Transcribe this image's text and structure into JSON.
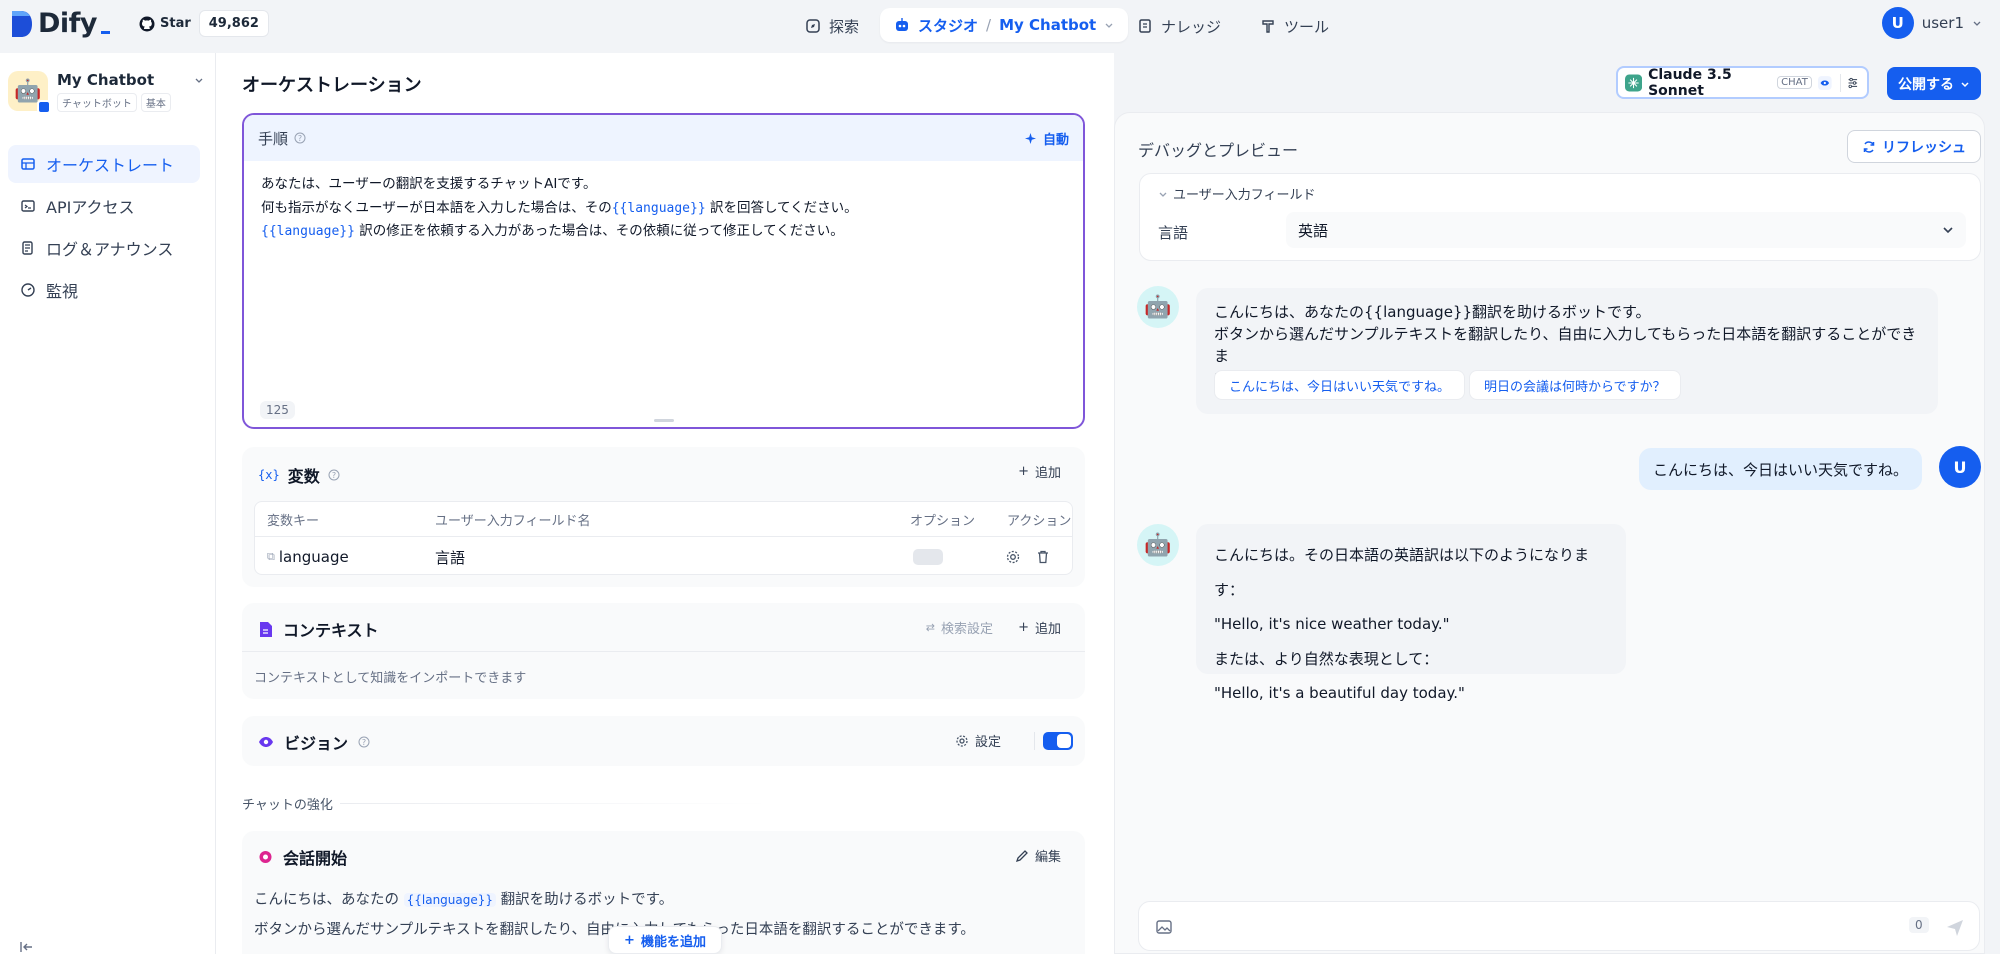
{
  "topnav": {
    "logo": "Dify",
    "star_label": "Star",
    "star_count": "49,862",
    "explore": "探索",
    "studio": "スタジオ",
    "app_crumb": "My Chatbot",
    "knowledge": "ナレッジ",
    "tools": "ツール",
    "user_initial": "U",
    "user_name": "user1"
  },
  "sidebar": {
    "app_name": "My Chatbot",
    "tag_type": "チャットボット",
    "tag_mode": "基本",
    "items": [
      {
        "label": "オーケストレート",
        "icon": "orchestrate-icon"
      },
      {
        "label": "APIアクセス",
        "icon": "terminal-icon"
      },
      {
        "label": "ログ＆アナウンス",
        "icon": "logs-icon"
      },
      {
        "label": "監視",
        "icon": "monitor-icon"
      }
    ]
  },
  "main": {
    "title": "オーケストレーション",
    "prompt": {
      "title": "手順",
      "auto_label": "自動",
      "line1": "あなたは、ユーザーの翻訳を支援するチャットAIです。",
      "line2_a": "何も指示がなくユーザーが日本語を入力した場合は、その",
      "var": "{{language}}",
      "line2_b": "訳を回答してください。",
      "line3_b": "訳の修正を依頼する入力があった場合は、その依頼に従って修正してください。",
      "count": "125"
    },
    "variables": {
      "title": "変数",
      "add": "追加",
      "headers": [
        "変数キー",
        "ユーザー入力フィールド名",
        "オプション",
        "アクション"
      ],
      "row": {
        "key": "language",
        "name": "言語"
      }
    },
    "context": {
      "title": "コンテキスト",
      "retrieval": "検索設定",
      "add": "追加",
      "desc": "コンテキストとして知識をインポートできます"
    },
    "vision": {
      "title": "ビジョン",
      "settings": "設定"
    },
    "chat_enhance": "チャットの強化",
    "opener": {
      "title": "会話開始",
      "edit": "編集",
      "line1_a": "こんにちは、あなたの",
      "var": "{{language}}",
      "line1_b": "翻訳を助けるボットです。",
      "line2": "ボタンから選んだサンプルテキストを翻訳したり、自由に入力してもらった日本語を翻訳することができます。"
    },
    "add_feature": "機能を追加"
  },
  "right": {
    "model_name": "Claude 3.5 Sonnet",
    "model_badge": "CHAT",
    "publish": "公開する",
    "debug_title": "デバッグとプレビュー",
    "refresh": "リフレッシュ",
    "input_fields_label": "ユーザー入力フィールド",
    "lang_label": "言語",
    "lang_value": "英語",
    "msg1_line1": "こんにちは、あなたの{{language}}翻訳を助けるボットです。",
    "msg1_line2": "ボタンから選んだサンプルテキストを翻訳したり、自由に入力してもらった日本語を翻訳することができま",
    "msg1_line3": "す。",
    "suggestion1": "こんにちは、今日はいい天気ですね。",
    "suggestion2": "明日の会議は何時からですか？",
    "user_msg": "こんにちは、今日はいい天気ですね。",
    "user_initial": "U",
    "msg2_line1": "こんにちは。その日本語の英語訳は以下のようになります：",
    "msg2_line2": "\"Hello, it's nice weather today.\"",
    "msg2_line3": "または、より自然な表現として：",
    "msg2_line4": "\"Hello, it's a beautiful day today.\"",
    "input_count": "0"
  }
}
